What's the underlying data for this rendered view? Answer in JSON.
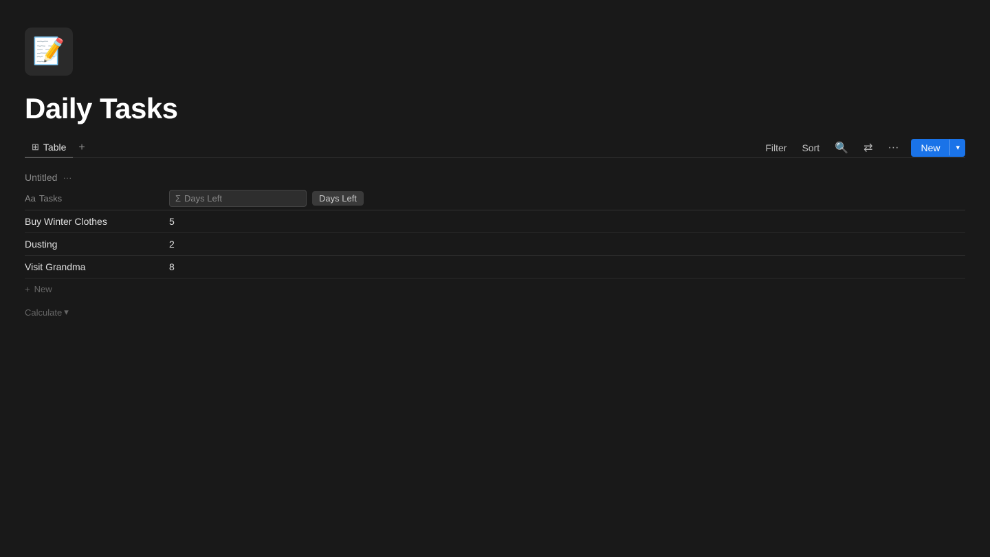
{
  "app": {
    "icon": "📝",
    "title": "Daily Tasks"
  },
  "tabs": [
    {
      "id": "table",
      "label": "Table",
      "icon": "⊞",
      "active": true
    }
  ],
  "tab_add_label": "+",
  "toolbar": {
    "filter_label": "Filter",
    "sort_label": "Sort",
    "search_icon": "🔍",
    "options_icon": "⇄",
    "more_icon": "···",
    "new_label": "New",
    "new_chevron": "▾"
  },
  "table": {
    "group_title": "Untitled",
    "group_more": "···",
    "columns": [
      {
        "id": "tasks",
        "icon": "Aa",
        "label": "Tasks"
      },
      {
        "id": "days_left",
        "icon": "Σ",
        "label": "Days Left"
      }
    ],
    "active_column_pill": "Days Left",
    "rows": [
      {
        "task": "Buy Winter Clothes",
        "days_left": "5"
      },
      {
        "task": "Dusting",
        "days_left": "2"
      },
      {
        "task": "Visit Grandma",
        "days_left": "8"
      }
    ],
    "add_row_label": "New",
    "calculate_label": "Calculate",
    "calculate_chevron": "▾"
  }
}
